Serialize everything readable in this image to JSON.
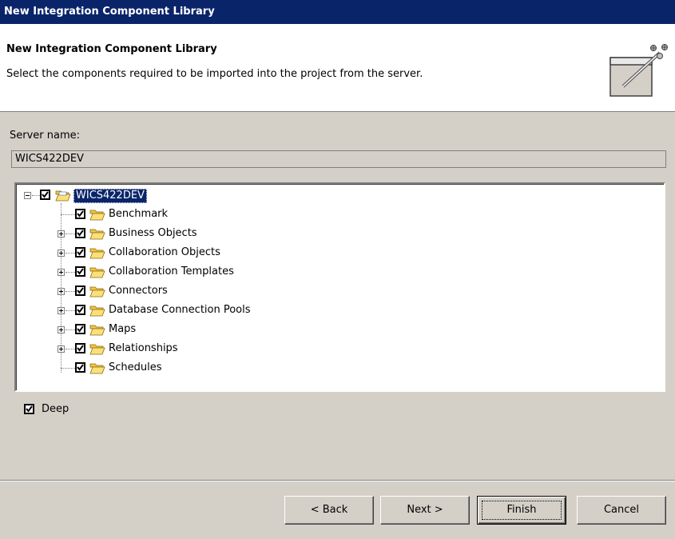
{
  "window": {
    "title": "New Integration Component Library"
  },
  "banner": {
    "title": "New Integration Component Library",
    "description": "Select the components required to be imported into the project from the server.",
    "icon": "wizard-banner-icon"
  },
  "server": {
    "label": "Server name:",
    "value": "WICS422DEV"
  },
  "tree": {
    "root": {
      "label": "WICS422DEV",
      "checked": true,
      "expanded": true,
      "selected": true
    },
    "items": [
      {
        "label": "Benchmark",
        "checked": true,
        "expandable": false
      },
      {
        "label": "Business Objects",
        "checked": true,
        "expandable": true
      },
      {
        "label": "Collaboration Objects",
        "checked": true,
        "expandable": true
      },
      {
        "label": "Collaboration Templates",
        "checked": true,
        "expandable": true
      },
      {
        "label": "Connectors",
        "checked": true,
        "expandable": true
      },
      {
        "label": "Database Connection Pools",
        "checked": true,
        "expandable": true
      },
      {
        "label": "Maps",
        "checked": true,
        "expandable": true
      },
      {
        "label": "Relationships",
        "checked": true,
        "expandable": true
      },
      {
        "label": "Schedules",
        "checked": true,
        "expandable": false
      }
    ]
  },
  "deep": {
    "label": "Deep",
    "checked": true
  },
  "buttons": {
    "back": "< Back",
    "next": "Next >",
    "finish": "Finish",
    "cancel": "Cancel"
  },
  "colors": {
    "titlebar": "#0a246a",
    "dialog_bg": "#d4d0c8",
    "folder": "#f5c542"
  }
}
